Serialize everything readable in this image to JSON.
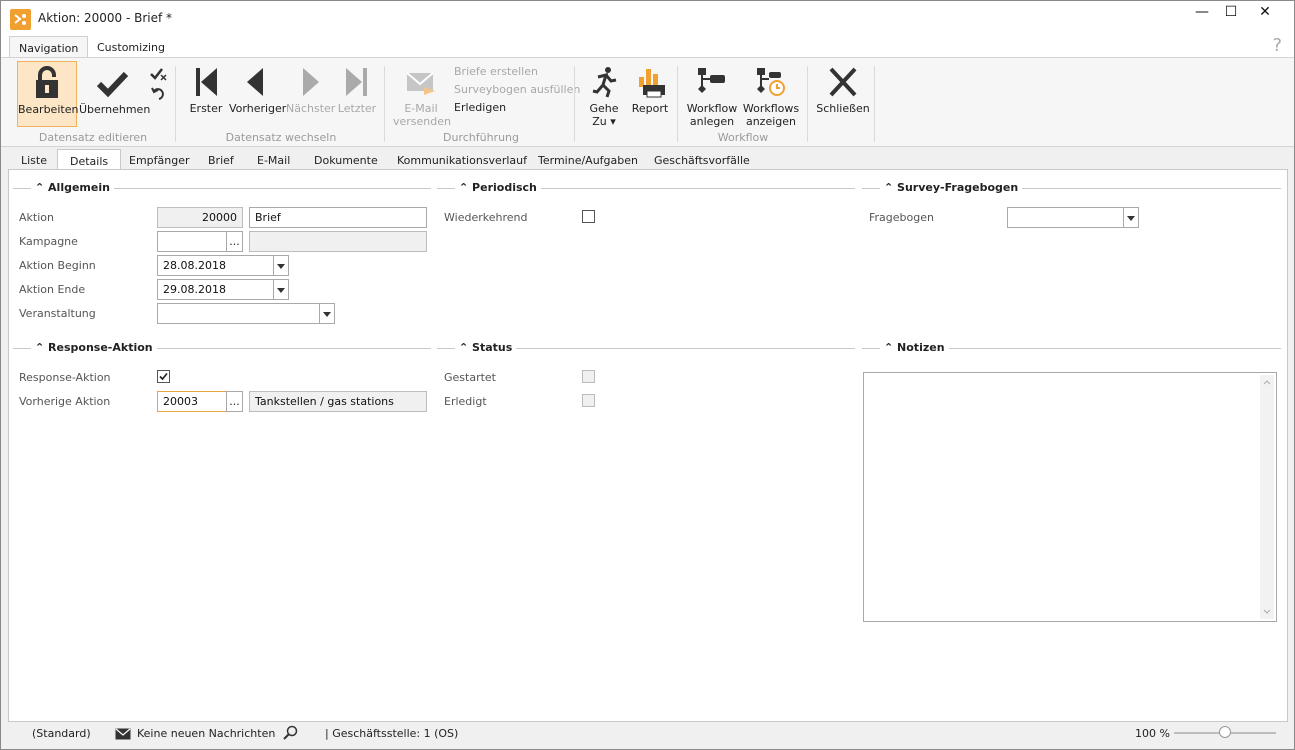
{
  "window": {
    "title": "Aktion: 20000 - Brief *",
    "controls": [
      "—",
      "☐",
      "✕"
    ]
  },
  "ribbon_tabs": [
    {
      "label": "Navigation"
    },
    {
      "label": "Customizing"
    }
  ],
  "help": "?",
  "ribbon": {
    "bearbeiten": "Bearbeiten",
    "uebernehmen": "Übernehmen",
    "group1": "Datensatz editieren",
    "erster": "Erster",
    "vorheriger": "Vorheriger",
    "naechster": "Nächster",
    "letzter": "Letzter",
    "group2": "Datensatz wechseln",
    "email_l1": "E-Mail",
    "email_l2": "versenden",
    "briefe": "Briefe erstellen",
    "survey": "Surveybogen ausfüllen",
    "erledigen": "Erledigen",
    "group3": "Durchführung",
    "gehe_l1": "Gehe",
    "gehe_l2": "Zu ▾",
    "report": "Report",
    "wf_anlegen_l1": "Workflow",
    "wf_anlegen_l2": "anlegen",
    "wf_anzeigen_l1": "Workflows",
    "wf_anzeigen_l2": "anzeigen",
    "group4": "Workflow",
    "schliessen": "Schließen"
  },
  "doc_tabs": [
    "Liste",
    "Details",
    "Empfänger",
    "Brief",
    "E-Mail",
    "Dokumente",
    "Kommunikationsverlauf",
    "Termine/Aufgaben",
    "Geschäftsvorfälle"
  ],
  "sections": {
    "allgemein": "Allgemein",
    "periodisch": "Periodisch",
    "survey": "Survey-Fragebogen",
    "response": "Response-Aktion",
    "status": "Status",
    "notizen": "Notizen"
  },
  "allgemein": {
    "aktion_label": "Aktion",
    "aktion_nr": "20000",
    "aktion_name": "Brief",
    "kampagne_label": "Kampagne",
    "kampagne_value": "",
    "beginn_label": "Aktion Beginn",
    "beginn_value": "28.08.2018",
    "ende_label": "Aktion Ende",
    "ende_value": "29.08.2018",
    "veranstaltung_label": "Veranstaltung",
    "veranstaltung_value": ""
  },
  "periodisch": {
    "wiederkehrend_label": "Wiederkehrend",
    "wiederkehrend_checked": false
  },
  "survey": {
    "fragebogen_label": "Fragebogen",
    "fragebogen_value": ""
  },
  "response": {
    "response_label": "Response-Aktion",
    "response_checked": true,
    "vorherige_label": "Vorherige Aktion",
    "vorherige_value": "20003",
    "vorherige_name": "Tankstellen / gas stations"
  },
  "status": {
    "gestartet_label": "Gestartet",
    "erledigt_label": "Erledigt"
  },
  "statusbar": {
    "standard": "(Standard)",
    "nachrichten": "Keine neuen Nachrichten",
    "geschaeftsstelle": "| Geschäftsstelle:  1 (OS)",
    "zoom": "100 %",
    "zoom_level": 0.5
  },
  "ellipsis": "...",
  "colors": {
    "accent": "#f0a030",
    "selected_bg": "#fde6c6"
  }
}
